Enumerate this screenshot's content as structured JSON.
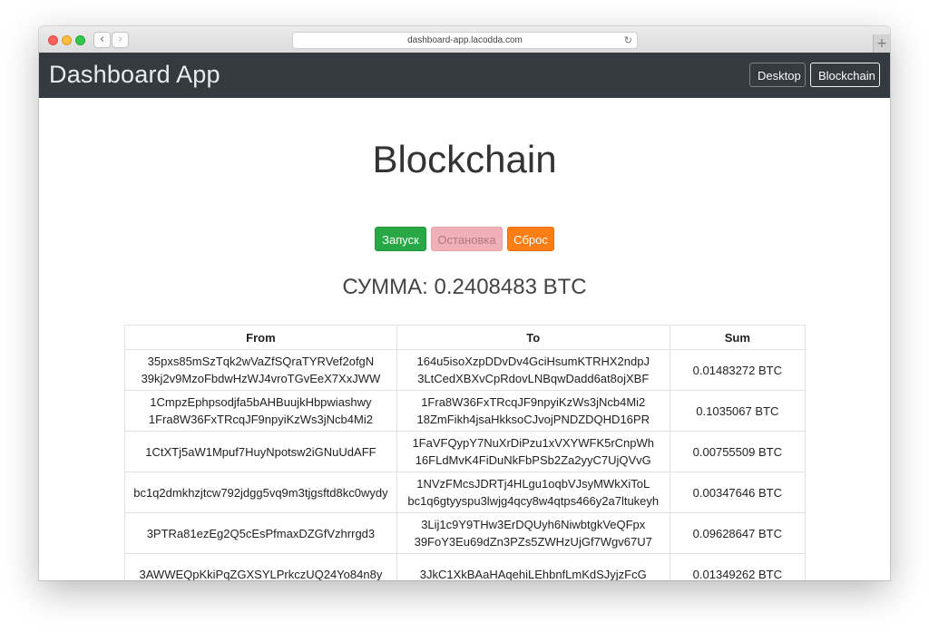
{
  "browser": {
    "url": "dashboard-app.lacodda.com",
    "back_glyph": "‹",
    "forward_glyph": "›",
    "reload_glyph": "↻",
    "new_tab_glyph": "+"
  },
  "navbar": {
    "brand": "Dashboard App",
    "links": [
      {
        "label": "Desktop",
        "active": false
      },
      {
        "label": "Blockchain",
        "active": true
      }
    ]
  },
  "page": {
    "title": "Blockchain",
    "buttons": {
      "start": "Запуск",
      "stop": "Остановка",
      "reset": "Сброс"
    },
    "sum_text": "СУММА: 0.2408483 BTC"
  },
  "table": {
    "headers": [
      "From",
      "To",
      "Sum"
    ],
    "rows": [
      {
        "from": [
          "35pxs85mSzTqk2wVaZfSQraTYRVef2ofgN",
          "39kj2v9MzoFbdwHzWJ4vroTGvEeX7XxJWW"
        ],
        "to": [
          "164u5isoXzpDDvDv4GciHsumKTRHX2ndpJ",
          "3LtCedXBXvCpRdovLNBqwDadd6at8ojXBF"
        ],
        "sum": "0.01483272 BTC"
      },
      {
        "from": [
          "1CmpzEphpsodjfa5bAHBuujkHbpwiashwy",
          "1Fra8W36FxTRcqJF9npyiKzWs3jNcb4Mi2"
        ],
        "to": [
          "1Fra8W36FxTRcqJF9npyiKzWs3jNcb4Mi2",
          "18ZmFikh4jsaHkksoCJvojPNDZDQHD16PR"
        ],
        "sum": "0.1035067 BTC"
      },
      {
        "from": [
          "1CtXTj5aW1Mpuf7HuyNpotsw2iGNuUdAFF",
          ""
        ],
        "to": [
          "1FaVFQypY7NuXrDiPzu1xVXYWFK5rCnpWh",
          "16FLdMvK4FiDuNkFbPSb2Za2yyC7UjQVvG"
        ],
        "sum": "0.00755509 BTC"
      },
      {
        "from": [
          "bc1q2dmkhzjtcw792jdgg5vq9m3tjgsftd8kc0wydy",
          ""
        ],
        "to": [
          "1NVzFMcsJDRTj4HLgu1oqbVJsyMWkXiToL",
          "bc1q6gtyyspu3lwjg4qcy8w4qtps466y2a7ltukeyh"
        ],
        "sum": "0.00347646 BTC"
      },
      {
        "from": [
          "3PTRa81ezEg2Q5cEsPfmaxDZGfVzhrrgd3",
          ""
        ],
        "to": [
          "3Lij1c9Y9THw3ErDQUyh6NiwbtgkVeQFpx",
          "39FoY3Eu69dZn3PZs5ZWHzUjGf7Wgv67U7"
        ],
        "sum": "0.09628647 BTC"
      },
      {
        "from": [
          "3AWWEQpKkiPqZGXSYLPrkczUQ24Yo84n8y",
          ""
        ],
        "to": [
          "3JkC1XkBAaHAqehiLEhbnfLmKdSJyjzFcG",
          ""
        ],
        "sum": "0.01349262 BTC"
      }
    ]
  }
}
